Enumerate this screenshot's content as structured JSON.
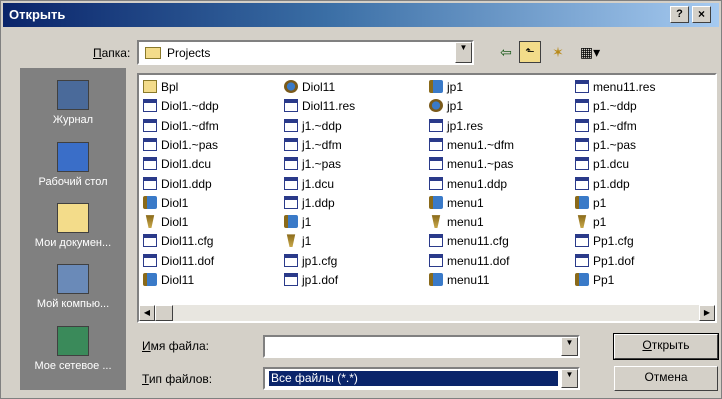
{
  "window": {
    "title": "Открыть",
    "help_label": "?",
    "close_label": "×"
  },
  "lookin": {
    "label_prefix": "",
    "label_accel": "П",
    "label_rest": "апка:",
    "value": "Projects"
  },
  "toolbar": {
    "back_icon": "⇦",
    "up_icon": "⬑",
    "new_folder_icon": "✶",
    "view_icon": "▦▾"
  },
  "places": [
    {
      "label": "Журнал",
      "icon": "history-icon",
      "color": "#4a6a9a"
    },
    {
      "label": "Рабочий стол",
      "icon": "desktop-icon",
      "color": "#3a6ec8"
    },
    {
      "label": "Мои докумен...",
      "icon": "my-documents-icon",
      "color": "#f3dc8a"
    },
    {
      "label": "Мой компью...",
      "icon": "my-computer-icon",
      "color": "#6a8ab8"
    },
    {
      "label": "Мое сетевое ...",
      "icon": "network-icon",
      "color": "#3a8a5a"
    }
  ],
  "files": {
    "columns": [
      [
        {
          "name": "Bpl",
          "type": "folder"
        },
        {
          "name": "Diol1.~ddp",
          "type": "doc"
        },
        {
          "name": "Diol1.~dfm",
          "type": "doc"
        },
        {
          "name": "Diol1.~pas",
          "type": "doc"
        },
        {
          "name": "Diol1.dcu",
          "type": "doc"
        },
        {
          "name": "Diol1.ddp",
          "type": "doc"
        },
        {
          "name": "Diol1",
          "type": "proj"
        },
        {
          "name": "Diol1",
          "type": "unit"
        },
        {
          "name": "Diol11.cfg",
          "type": "doc"
        },
        {
          "name": "Diol11.dof",
          "type": "doc"
        },
        {
          "name": "Diol11",
          "type": "proj"
        }
      ],
      [
        {
          "name": "Diol11",
          "type": "app"
        },
        {
          "name": "Diol11.res",
          "type": "doc"
        },
        {
          "name": "j1.~ddp",
          "type": "doc"
        },
        {
          "name": "j1.~dfm",
          "type": "doc"
        },
        {
          "name": "j1.~pas",
          "type": "doc"
        },
        {
          "name": "j1.dcu",
          "type": "doc"
        },
        {
          "name": "j1.ddp",
          "type": "doc"
        },
        {
          "name": "j1",
          "type": "proj"
        },
        {
          "name": "j1",
          "type": "unit"
        },
        {
          "name": "jp1.cfg",
          "type": "doc"
        },
        {
          "name": "jp1.dof",
          "type": "doc"
        }
      ],
      [
        {
          "name": "jp1",
          "type": "proj"
        },
        {
          "name": "jp1",
          "type": "app"
        },
        {
          "name": "jp1.res",
          "type": "doc"
        },
        {
          "name": "menu1.~dfm",
          "type": "doc"
        },
        {
          "name": "menu1.~pas",
          "type": "doc"
        },
        {
          "name": "menu1.ddp",
          "type": "doc"
        },
        {
          "name": "menu1",
          "type": "proj"
        },
        {
          "name": "menu1",
          "type": "unit"
        },
        {
          "name": "menu11.cfg",
          "type": "doc"
        },
        {
          "name": "menu11.dof",
          "type": "doc"
        },
        {
          "name": "menu11",
          "type": "proj"
        }
      ],
      [
        {
          "name": "menu11.res",
          "type": "doc"
        },
        {
          "name": "p1.~ddp",
          "type": "doc"
        },
        {
          "name": "p1.~dfm",
          "type": "doc"
        },
        {
          "name": "p1.~pas",
          "type": "doc"
        },
        {
          "name": "p1.dcu",
          "type": "doc"
        },
        {
          "name": "p1.ddp",
          "type": "doc"
        },
        {
          "name": "p1",
          "type": "proj"
        },
        {
          "name": "p1",
          "type": "unit"
        },
        {
          "name": "Pp1.cfg",
          "type": "doc"
        },
        {
          "name": "Pp1.dof",
          "type": "doc"
        },
        {
          "name": "Pp1",
          "type": "proj"
        }
      ]
    ]
  },
  "filename": {
    "label_accel": "И",
    "label_rest": "мя файла:",
    "value": ""
  },
  "filetype": {
    "label_accel": "Т",
    "label_rest": "ип файлов:",
    "value": "Все файлы (*.*)"
  },
  "buttons": {
    "open_accel": "О",
    "open_rest": "ткрыть",
    "cancel": "Отмена"
  },
  "scroll": {
    "left": "◀",
    "right": "▶"
  }
}
